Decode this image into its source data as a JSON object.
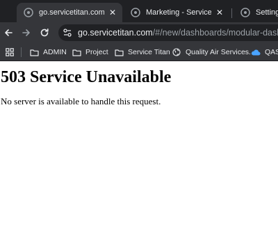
{
  "tabs": [
    {
      "title": "go.servicetitan.com/#/new",
      "active": true,
      "close": "✕"
    },
    {
      "title": "Marketing - ServiceTitan",
      "active": false,
      "close": "✕"
    },
    {
      "title": "Settings -",
      "active": false
    }
  ],
  "toolbar": {
    "url_host": "go.servicetitan.com",
    "url_path": "/#/new/dashboards/modular-dashboard"
  },
  "bookmarks": [
    {
      "label": "ADMIN",
      "icon": "folder-icon"
    },
    {
      "label": "Project",
      "icon": "folder-icon"
    },
    {
      "label": "Service Titan",
      "icon": "folder-icon"
    },
    {
      "label": "Quality Air Services...",
      "icon": "globe-icon"
    },
    {
      "label": "QAS -",
      "icon": "cloud-icon"
    }
  ],
  "page": {
    "heading": "503 Service Unavailable",
    "message": "No server is available to handle this request."
  },
  "colors": {
    "tabstrip_bg": "#202124",
    "toolbar_bg": "#35363a",
    "text_light": "#e8eaed",
    "url_path": "#9aa0a6",
    "cloud_blue": "#4aa3ff"
  }
}
